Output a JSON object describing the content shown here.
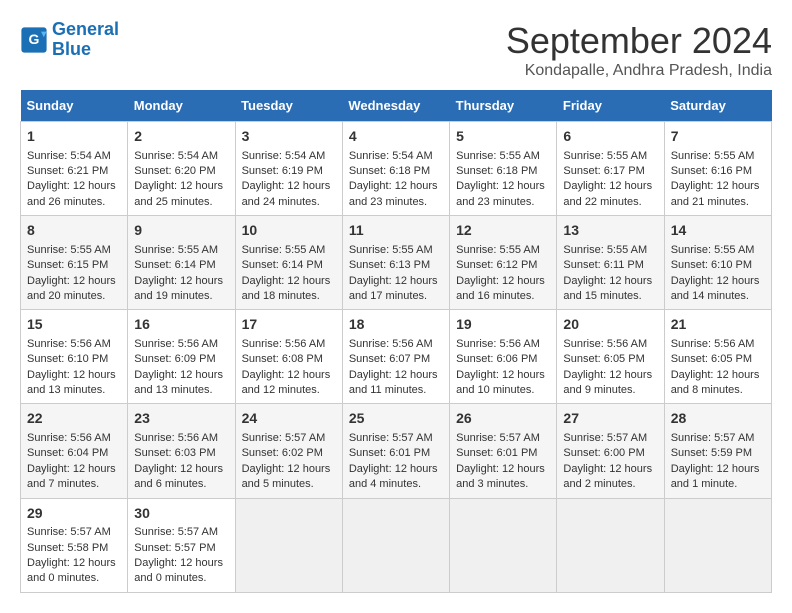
{
  "header": {
    "logo_line1": "General",
    "logo_line2": "Blue",
    "title": "September 2024",
    "subtitle": "Kondapalle, Andhra Pradesh, India"
  },
  "weekdays": [
    "Sunday",
    "Monday",
    "Tuesday",
    "Wednesday",
    "Thursday",
    "Friday",
    "Saturday"
  ],
  "weeks": [
    [
      {
        "day": "1",
        "lines": [
          "Sunrise: 5:54 AM",
          "Sunset: 6:21 PM",
          "Daylight: 12 hours",
          "and 26 minutes."
        ]
      },
      {
        "day": "2",
        "lines": [
          "Sunrise: 5:54 AM",
          "Sunset: 6:20 PM",
          "Daylight: 12 hours",
          "and 25 minutes."
        ]
      },
      {
        "day": "3",
        "lines": [
          "Sunrise: 5:54 AM",
          "Sunset: 6:19 PM",
          "Daylight: 12 hours",
          "and 24 minutes."
        ]
      },
      {
        "day": "4",
        "lines": [
          "Sunrise: 5:54 AM",
          "Sunset: 6:18 PM",
          "Daylight: 12 hours",
          "and 23 minutes."
        ]
      },
      {
        "day": "5",
        "lines": [
          "Sunrise: 5:55 AM",
          "Sunset: 6:18 PM",
          "Daylight: 12 hours",
          "and 23 minutes."
        ]
      },
      {
        "day": "6",
        "lines": [
          "Sunrise: 5:55 AM",
          "Sunset: 6:17 PM",
          "Daylight: 12 hours",
          "and 22 minutes."
        ]
      },
      {
        "day": "7",
        "lines": [
          "Sunrise: 5:55 AM",
          "Sunset: 6:16 PM",
          "Daylight: 12 hours",
          "and 21 minutes."
        ]
      }
    ],
    [
      {
        "day": "8",
        "lines": [
          "Sunrise: 5:55 AM",
          "Sunset: 6:15 PM",
          "Daylight: 12 hours",
          "and 20 minutes."
        ]
      },
      {
        "day": "9",
        "lines": [
          "Sunrise: 5:55 AM",
          "Sunset: 6:14 PM",
          "Daylight: 12 hours",
          "and 19 minutes."
        ]
      },
      {
        "day": "10",
        "lines": [
          "Sunrise: 5:55 AM",
          "Sunset: 6:14 PM",
          "Daylight: 12 hours",
          "and 18 minutes."
        ]
      },
      {
        "day": "11",
        "lines": [
          "Sunrise: 5:55 AM",
          "Sunset: 6:13 PM",
          "Daylight: 12 hours",
          "and 17 minutes."
        ]
      },
      {
        "day": "12",
        "lines": [
          "Sunrise: 5:55 AM",
          "Sunset: 6:12 PM",
          "Daylight: 12 hours",
          "and 16 minutes."
        ]
      },
      {
        "day": "13",
        "lines": [
          "Sunrise: 5:55 AM",
          "Sunset: 6:11 PM",
          "Daylight: 12 hours",
          "and 15 minutes."
        ]
      },
      {
        "day": "14",
        "lines": [
          "Sunrise: 5:55 AM",
          "Sunset: 6:10 PM",
          "Daylight: 12 hours",
          "and 14 minutes."
        ]
      }
    ],
    [
      {
        "day": "15",
        "lines": [
          "Sunrise: 5:56 AM",
          "Sunset: 6:10 PM",
          "Daylight: 12 hours",
          "and 13 minutes."
        ]
      },
      {
        "day": "16",
        "lines": [
          "Sunrise: 5:56 AM",
          "Sunset: 6:09 PM",
          "Daylight: 12 hours",
          "and 13 minutes."
        ]
      },
      {
        "day": "17",
        "lines": [
          "Sunrise: 5:56 AM",
          "Sunset: 6:08 PM",
          "Daylight: 12 hours",
          "and 12 minutes."
        ]
      },
      {
        "day": "18",
        "lines": [
          "Sunrise: 5:56 AM",
          "Sunset: 6:07 PM",
          "Daylight: 12 hours",
          "and 11 minutes."
        ]
      },
      {
        "day": "19",
        "lines": [
          "Sunrise: 5:56 AM",
          "Sunset: 6:06 PM",
          "Daylight: 12 hours",
          "and 10 minutes."
        ]
      },
      {
        "day": "20",
        "lines": [
          "Sunrise: 5:56 AM",
          "Sunset: 6:05 PM",
          "Daylight: 12 hours",
          "and 9 minutes."
        ]
      },
      {
        "day": "21",
        "lines": [
          "Sunrise: 5:56 AM",
          "Sunset: 6:05 PM",
          "Daylight: 12 hours",
          "and 8 minutes."
        ]
      }
    ],
    [
      {
        "day": "22",
        "lines": [
          "Sunrise: 5:56 AM",
          "Sunset: 6:04 PM",
          "Daylight: 12 hours",
          "and 7 minutes."
        ]
      },
      {
        "day": "23",
        "lines": [
          "Sunrise: 5:56 AM",
          "Sunset: 6:03 PM",
          "Daylight: 12 hours",
          "and 6 minutes."
        ]
      },
      {
        "day": "24",
        "lines": [
          "Sunrise: 5:57 AM",
          "Sunset: 6:02 PM",
          "Daylight: 12 hours",
          "and 5 minutes."
        ]
      },
      {
        "day": "25",
        "lines": [
          "Sunrise: 5:57 AM",
          "Sunset: 6:01 PM",
          "Daylight: 12 hours",
          "and 4 minutes."
        ]
      },
      {
        "day": "26",
        "lines": [
          "Sunrise: 5:57 AM",
          "Sunset: 6:01 PM",
          "Daylight: 12 hours",
          "and 3 minutes."
        ]
      },
      {
        "day": "27",
        "lines": [
          "Sunrise: 5:57 AM",
          "Sunset: 6:00 PM",
          "Daylight: 12 hours",
          "and 2 minutes."
        ]
      },
      {
        "day": "28",
        "lines": [
          "Sunrise: 5:57 AM",
          "Sunset: 5:59 PM",
          "Daylight: 12 hours",
          "and 1 minute."
        ]
      }
    ],
    [
      {
        "day": "29",
        "lines": [
          "Sunrise: 5:57 AM",
          "Sunset: 5:58 PM",
          "Daylight: 12 hours",
          "and 0 minutes."
        ]
      },
      {
        "day": "30",
        "lines": [
          "Sunrise: 5:57 AM",
          "Sunset: 5:57 PM",
          "Daylight: 12 hours",
          "and 0 minutes."
        ]
      },
      {
        "day": "",
        "lines": []
      },
      {
        "day": "",
        "lines": []
      },
      {
        "day": "",
        "lines": []
      },
      {
        "day": "",
        "lines": []
      },
      {
        "day": "",
        "lines": []
      }
    ]
  ]
}
